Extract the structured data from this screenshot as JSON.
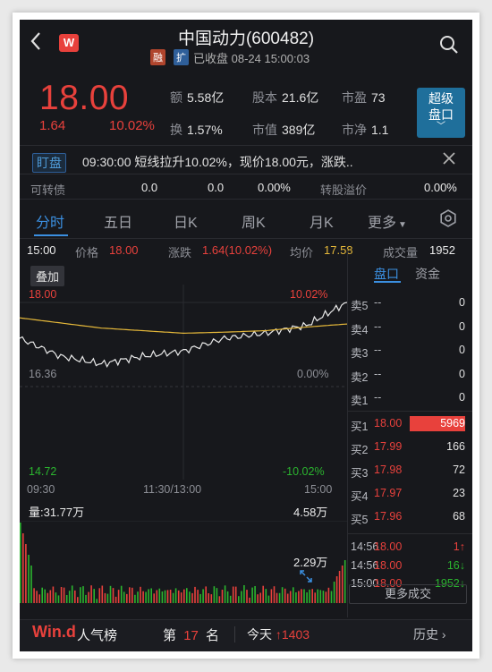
{
  "header": {
    "title": "中国动力(600482)",
    "logo_text": "W",
    "tag_rong": "融",
    "tag_kuo": "扩",
    "status": "已收盘 08-24 15:00:03"
  },
  "quote": {
    "price": "18.00",
    "change": "1.64",
    "change_pct": "10.02%",
    "stats": [
      {
        "k": "额",
        "v": "5.58亿"
      },
      {
        "k": "股本",
        "v": "21.6亿"
      },
      {
        "k": "市盈",
        "v": "73"
      },
      {
        "k": "换",
        "v": "1.57%"
      },
      {
        "k": "市值",
        "v": "389亿"
      },
      {
        "k": "市净",
        "v": "1.1"
      }
    ],
    "level_button_line1": "超级",
    "level_button_line2": "盘口",
    "level_button_arrow": "﹀"
  },
  "dingpan": {
    "tag": "盯盘",
    "text": "09:30:00 短线拉升10.02%，现价18.00元，涨跌.."
  },
  "convertible": {
    "label": "可转债",
    "v1": "0.0",
    "v2": "0.0",
    "v3": "0.00%",
    "premium_label": "转股溢价",
    "premium_value": "0.00%"
  },
  "tabs": [
    "分时",
    "五日",
    "日K",
    "周K",
    "月K",
    "更多"
  ],
  "info_row": {
    "time": "15:00",
    "price_label": "价格",
    "price": "18.00",
    "chg_label": "涨跌",
    "chg": "1.64(10.02%)",
    "avg_label": "均价",
    "avg": "17.58",
    "vol_label": "成交量",
    "vol": "1952"
  },
  "overlay_button": "叠加",
  "chart_axis": {
    "top_price": "18.00",
    "top_pct": "10.02%",
    "mid_price": "16.36",
    "mid_pct": "0.00%",
    "bottom_price": "14.72",
    "bottom_pct": "-10.02%",
    "time_start": "09:30",
    "time_mid": "11:30/13:00",
    "time_end": "15:00"
  },
  "chart_data": {
    "type": "line",
    "x": [
      "09:30",
      "10:00",
      "10:30",
      "11:00",
      "11:30/13:00",
      "13:30",
      "14:00",
      "14:30",
      "15:00"
    ],
    "series": [
      {
        "values": [
          17.3,
          16.95,
          16.8,
          16.95,
          17.05,
          17.3,
          17.4,
          17.55,
          18.0
        ]
      },
      {
        "values": [
          17.7,
          17.6,
          17.5,
          17.45,
          17.4,
          17.42,
          17.45,
          17.52,
          17.58
        ]
      }
    ],
    "ylim": [
      14.72,
      18.0
    ],
    "grid": true
  },
  "volume": {
    "label": "量:31.77万",
    "max": "4.58万",
    "mid": "2.29万"
  },
  "orderbook": {
    "tab_active": "盘口",
    "tab_other": "资金",
    "sells": [
      {
        "name": "卖5",
        "price": "--",
        "vol": "0"
      },
      {
        "name": "卖4",
        "price": "--",
        "vol": "0"
      },
      {
        "name": "卖3",
        "price": "--",
        "vol": "0"
      },
      {
        "name": "卖2",
        "price": "--",
        "vol": "0"
      },
      {
        "name": "卖1",
        "price": "--",
        "vol": "0"
      }
    ],
    "buys": [
      {
        "name": "买1",
        "price": "18.00",
        "vol": "5969"
      },
      {
        "name": "买2",
        "price": "17.99",
        "vol": "166"
      },
      {
        "name": "买3",
        "price": "17.98",
        "vol": "72"
      },
      {
        "name": "买4",
        "price": "17.97",
        "vol": "23"
      },
      {
        "name": "买5",
        "price": "17.96",
        "vol": "68"
      }
    ],
    "trades": [
      {
        "time": "14:56",
        "price": "18.00",
        "vol": "1↑"
      },
      {
        "time": "14:56",
        "price": "18.00",
        "vol": "16↓"
      },
      {
        "time": "15:00",
        "price": "18.00",
        "vol": "1952↓"
      }
    ],
    "more_trades": "更多成交"
  },
  "bottom_bar": {
    "brand": "Win.d",
    "brand_sub": "人气榜",
    "rank_prefix": "第",
    "rank": "17",
    "rank_suffix": "名",
    "today_label": "今天",
    "today_value": "↑1403",
    "history": "历史"
  },
  "colors": {
    "up": "#e8413c",
    "down": "#2bb52f",
    "accent": "#3b8fe0",
    "avg_line": "#e5b83a",
    "background": "#17181c"
  }
}
